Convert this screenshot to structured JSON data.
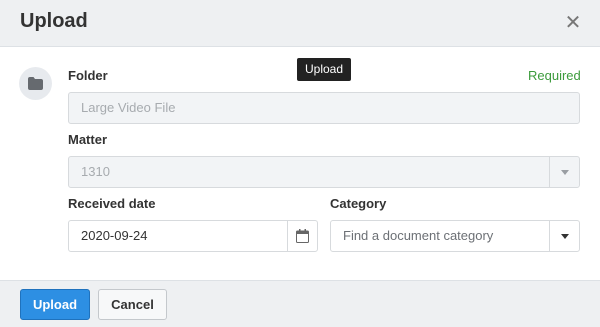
{
  "dialog": {
    "title": "Upload",
    "close_icon": "close-icon"
  },
  "tooltip": {
    "text": "Upload"
  },
  "form": {
    "folder": {
      "icon": "folder-icon",
      "label": "Folder",
      "required_text": "Required",
      "value": "Large Video File"
    },
    "matter": {
      "label": "Matter",
      "value": "1310",
      "icon": "chevron-down-icon"
    },
    "received_date": {
      "label": "Received date",
      "value": "2020-09-24",
      "icon": "calendar-icon"
    },
    "category": {
      "label": "Category",
      "placeholder": "Find a document category",
      "icon": "chevron-down-icon"
    }
  },
  "footer": {
    "upload_label": "Upload",
    "cancel_label": "Cancel"
  },
  "colors": {
    "header_bg": "#eef0f2",
    "primary": "#2d8fe3",
    "required": "#3c9b3c"
  }
}
